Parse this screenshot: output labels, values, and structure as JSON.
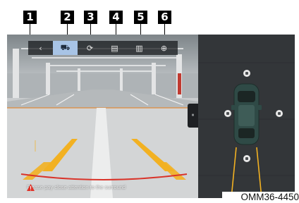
{
  "callouts": [
    "1",
    "2",
    "3",
    "4",
    "5",
    "6"
  ],
  "toolbar": {
    "buttons": [
      {
        "name": "back-button",
        "glyph": "‹"
      },
      {
        "name": "rear-view-button",
        "glyph": "⛟"
      },
      {
        "name": "surround-view-button",
        "glyph": "⟳"
      },
      {
        "name": "front-view-button",
        "glyph": "▤"
      },
      {
        "name": "top-view-button",
        "glyph": "▥"
      },
      {
        "name": "settings-button",
        "glyph": "⊕"
      }
    ]
  },
  "camera": {
    "warning_text": "Please pay close attention to the surround"
  },
  "side_tab": {
    "glyph": "⏸"
  },
  "figure_label": "OMM36-4450",
  "colors": {
    "guide_yellow": "#f2b122",
    "guide_red": "#d9342a",
    "vehicle": "#2f4a46",
    "active_button": "#a8c4e6"
  }
}
